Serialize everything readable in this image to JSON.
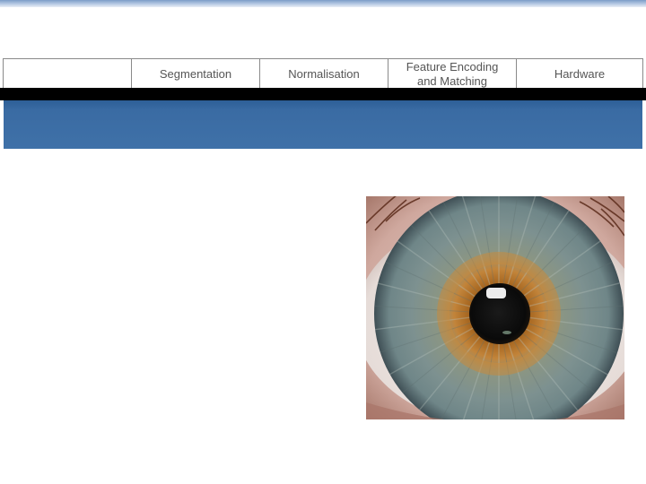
{
  "nav": {
    "tabs": [
      {
        "label": "Segmentation"
      },
      {
        "label": "Normalisation"
      },
      {
        "label": "Feature Encoding and Matching"
      },
      {
        "label": "Hardware"
      }
    ]
  },
  "colors": {
    "top_stripe": "#7b9cc8",
    "band": "#000000",
    "banner": "#3f71a8",
    "nav_text": "#555555"
  },
  "image": {
    "subject": "iris-close-up"
  }
}
